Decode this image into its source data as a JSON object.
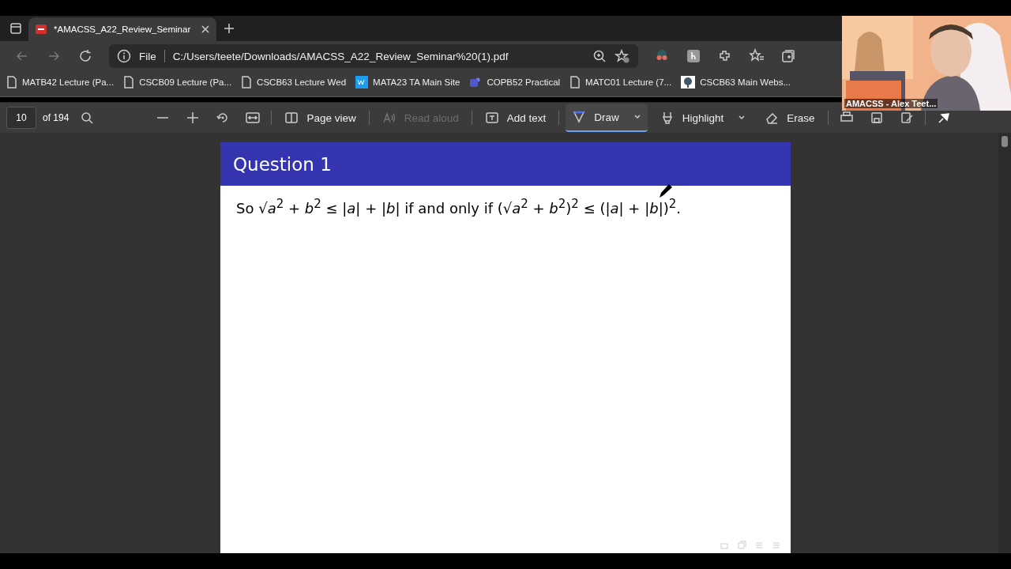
{
  "tab": {
    "title": "*AMACSS_A22_Review_Seminar",
    "selected": true
  },
  "address": {
    "scheme": "File",
    "url": "C:/Users/teete/Downloads/AMACSS_A22_Review_Seminar%20(1).pdf"
  },
  "bookmarks": [
    {
      "label": "MATB42 Lecture (Pa...",
      "kind": "page"
    },
    {
      "label": "CSCB09 Lecture (Pa...",
      "kind": "page"
    },
    {
      "label": "CSCB63 Lecture Wed",
      "kind": "page"
    },
    {
      "label": "MATA23 TA Main Site",
      "kind": "wp"
    },
    {
      "label": "COPB52 Practical",
      "kind": "teams"
    },
    {
      "label": "MATC01 Lecture (7...",
      "kind": "page"
    },
    {
      "label": "CSCB63 Main Webs...",
      "kind": "site"
    }
  ],
  "pdf_toolbar": {
    "page": "10",
    "total": "of 194",
    "tools": [
      {
        "label": "Page view",
        "kind": "pageview",
        "selected": false,
        "disabled": false
      },
      {
        "label": "Read aloud",
        "kind": "read",
        "selected": false,
        "disabled": true
      },
      {
        "label": "Add text",
        "kind": "text",
        "selected": false,
        "disabled": false
      },
      {
        "label": "Draw",
        "kind": "draw",
        "selected": true,
        "disabled": false
      },
      {
        "label": "Highlight",
        "kind": "highlight",
        "selected": false,
        "disabled": false
      },
      {
        "label": "Erase",
        "kind": "erase",
        "selected": false,
        "disabled": false
      }
    ]
  },
  "page": {
    "title": "Question 1",
    "text": "So √*a*$^{2}$ + *b*$^{2}$ ≤ |*a*| + |*b*| if and only if (√*a*$^{2}$ + *b*$^{2}$)$^{2}$ ≤ (|*a*| + |*b*|)$^{2}$."
  },
  "webcam": {
    "kind": "picture",
    "caption": "AMACSS - Alex Teet..."
  }
}
